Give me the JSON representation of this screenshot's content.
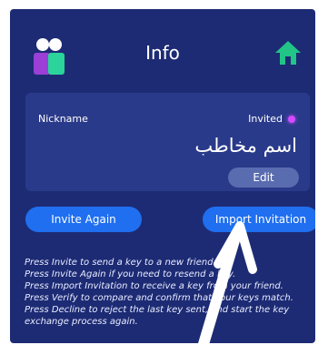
{
  "header": {
    "title": "Info",
    "left_icon": "contacts-icon",
    "right_icon": "home-icon"
  },
  "card": {
    "nickname_label": "Nickname",
    "status_text": "Invited",
    "status_color": "#d24cff",
    "contact_name": "اسم مخاطب",
    "edit_label": "Edit"
  },
  "actions": {
    "invite_again_label": "Invite Again",
    "import_invitation_label": "Import Invitation"
  },
  "help_lines": [
    "Press Invite to send a key to a new friend.",
    "Press Invite Again if you need to resend a key.",
    "Press Import Invitation to receive a key from your friend.",
    "Press Verify to compare and confirm that your keys match.",
    "Press Decline to reject the last key sent, and start the key exchange process again."
  ],
  "colors": {
    "background": "#1d2b74",
    "card": "#2a3a8a",
    "button": "#1f6ff0",
    "icon_purple": "#9b3fd6",
    "icon_green": "#2bd49a",
    "home_green": "#22c487"
  }
}
